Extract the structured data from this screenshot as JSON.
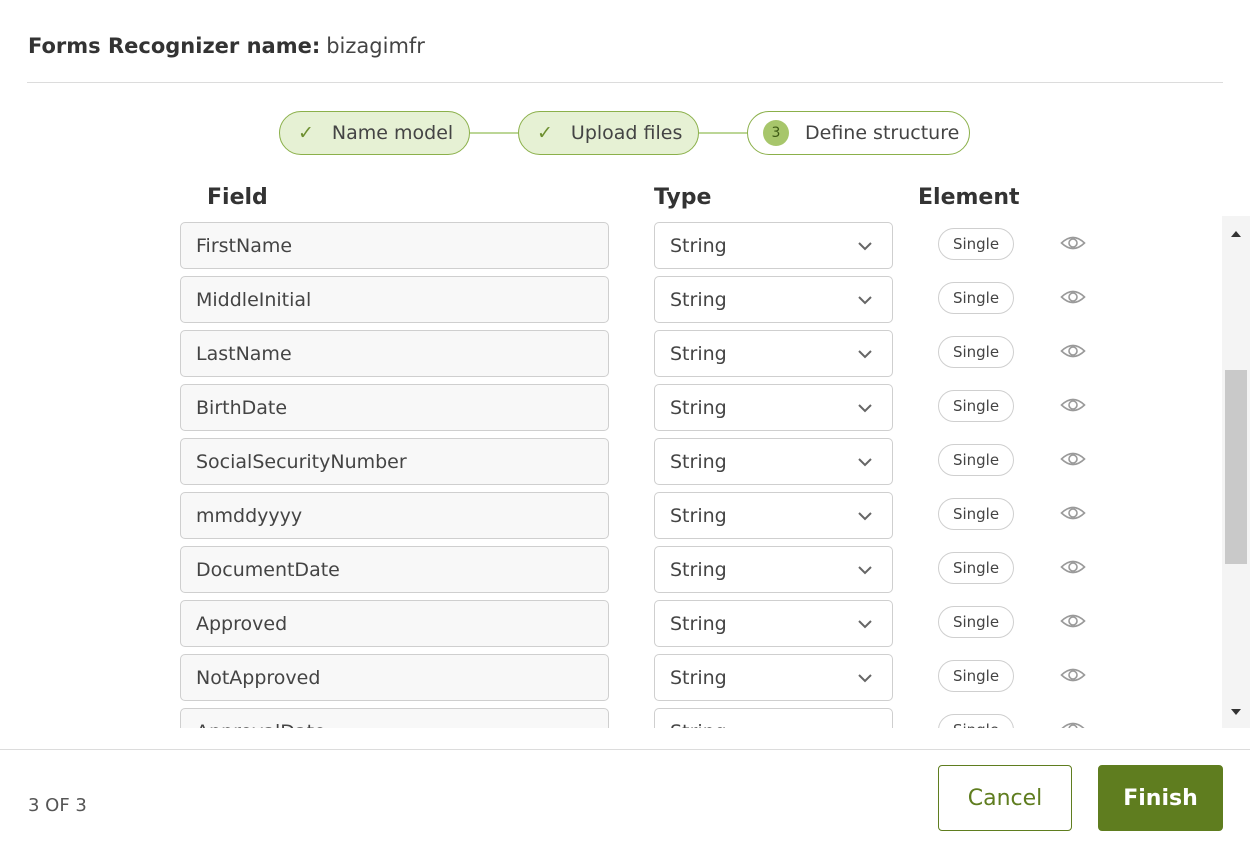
{
  "header": {
    "label": "Forms Recognizer name:",
    "value": "bizagimfr"
  },
  "steps": [
    {
      "label": "Name model",
      "state": "done"
    },
    {
      "label": "Upload files",
      "state": "done"
    },
    {
      "number": "3",
      "label": "Define structure",
      "state": "current"
    }
  ],
  "columns": {
    "field": "Field",
    "type": "Type",
    "element": "Element"
  },
  "rows": [
    {
      "field": "FirstName",
      "type": "String",
      "element": "Single"
    },
    {
      "field": "MiddleInitial",
      "type": "String",
      "element": "Single"
    },
    {
      "field": "LastName",
      "type": "String",
      "element": "Single"
    },
    {
      "field": "BirthDate",
      "type": "String",
      "element": "Single"
    },
    {
      "field": "SocialSecurityNumber",
      "type": "String",
      "element": "Single"
    },
    {
      "field": "mmddyyyy",
      "type": "String",
      "element": "Single"
    },
    {
      "field": "DocumentDate",
      "type": "String",
      "element": "Single"
    },
    {
      "field": "Approved",
      "type": "String",
      "element": "Single"
    },
    {
      "field": "NotApproved",
      "type": "String",
      "element": "Single"
    },
    {
      "field": "ApprovalDate",
      "type": "String",
      "element": "Single"
    }
  ],
  "footer": {
    "page_count": "3 OF 3",
    "cancel_label": "Cancel",
    "finish_label": "Finish"
  },
  "colors": {
    "accent": "#5f7d1f",
    "step_border": "#8bb04a",
    "step_fill": "#e6f1d4"
  },
  "icons": {
    "step_done": "check-icon",
    "type_select": "chevron-down-icon",
    "row_action": "eye-icon"
  }
}
